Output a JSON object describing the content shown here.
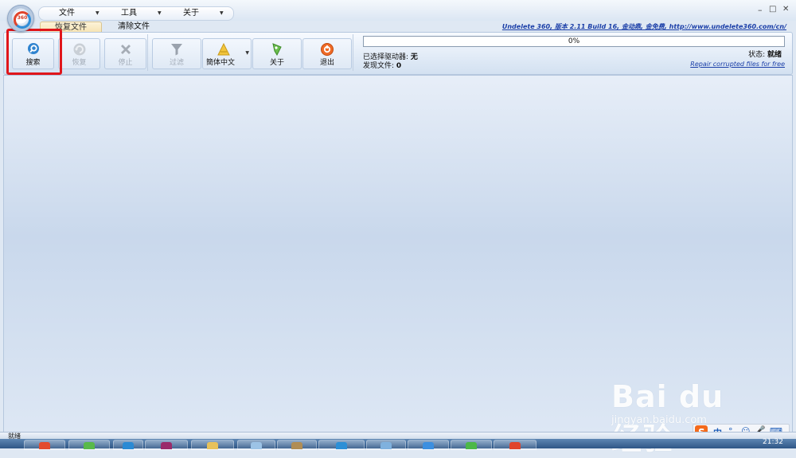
{
  "window": {
    "link_text": "Undelete 360, 版本 2.11 Build 16, 金动鼎, 金免费, http://www.undelete360.com/cn/",
    "min_label": "–",
    "max_label": "□",
    "close_label": "✕",
    "logo_text": "360"
  },
  "menu": [
    {
      "label": "文件"
    },
    {
      "label": "工具"
    },
    {
      "label": "关于"
    }
  ],
  "tabs": [
    {
      "label": "恢复文件",
      "active": true
    },
    {
      "label": "清除文件",
      "active": false
    }
  ],
  "toolbar": {
    "search": {
      "label": "搜索",
      "icon": "search-icon",
      "enabled": true
    },
    "recover": {
      "label": "恢复",
      "icon": "recover-icon",
      "enabled": false
    },
    "stop": {
      "label": "停止",
      "icon": "stop-icon",
      "enabled": false
    },
    "filter": {
      "label": "过滤",
      "icon": "filter-icon",
      "enabled": false
    },
    "language": {
      "label": "簡体中文",
      "icon": "language-icon",
      "enabled": true
    },
    "about": {
      "label": "关于",
      "icon": "about-icon",
      "enabled": true
    },
    "exit": {
      "label": "退出",
      "icon": "exit-icon",
      "enabled": true
    }
  },
  "status": {
    "progress_text": "0%",
    "progress_value": 0,
    "selected_drive_label": "已选择驱动器: ",
    "selected_drive_value": "无",
    "found_files_label": "发现文件: ",
    "found_files_value": "0",
    "state_label": "状态: ",
    "state_value": "就绪",
    "repair_link": "Repair corrupted files for free"
  },
  "statusbar": {
    "text": "就绪"
  },
  "ime": {
    "mode": "中",
    "punct": "°,",
    "emoji": "☺",
    "mic": "🎤",
    "kbd": "⌨"
  },
  "clock": {
    "time": "21:32"
  },
  "watermark": {
    "brand": "Bai du 经验",
    "url": "jingyan.baidu.com"
  },
  "colors": {
    "highlight": "#e0161b",
    "link": "#1b3fa8",
    "ribbon_bg": "#dde8f5"
  }
}
